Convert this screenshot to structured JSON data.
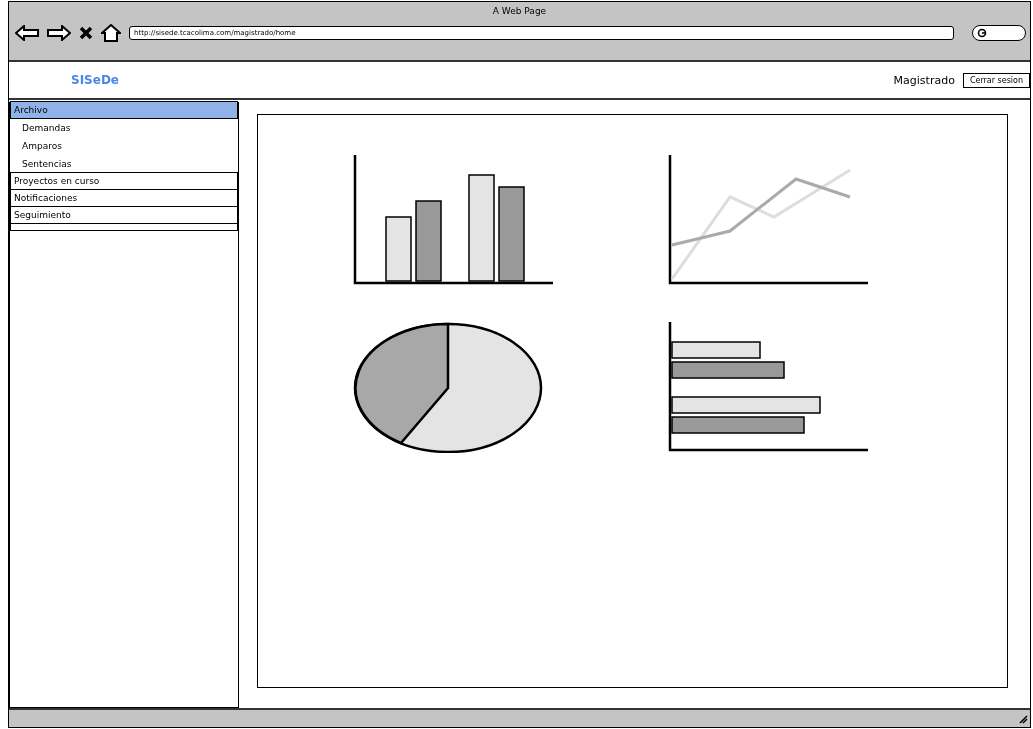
{
  "window": {
    "title": "A Web Page"
  },
  "address_bar": {
    "value": "http://sisede.tcacolima.com/magistrado/home"
  },
  "header": {
    "logo": "SISeDe",
    "user": "Magistrado",
    "logout_button": "Cerrar sesion"
  },
  "sidebar": {
    "items": [
      {
        "label": "Archivo",
        "selected": true,
        "children": [
          {
            "label": "Demandas"
          },
          {
            "label": "Amparos"
          },
          {
            "label": "Sentencias"
          }
        ]
      },
      {
        "label": "Proyectos en curso",
        "selected": false
      },
      {
        "label": "Notificaciones",
        "selected": false
      },
      {
        "label": "Seguimiento",
        "selected": false
      }
    ]
  },
  "dashboard": {
    "charts": [
      {
        "kind": "bar"
      },
      {
        "kind": "line"
      },
      {
        "kind": "pie"
      },
      {
        "kind": "hbar"
      }
    ]
  }
}
